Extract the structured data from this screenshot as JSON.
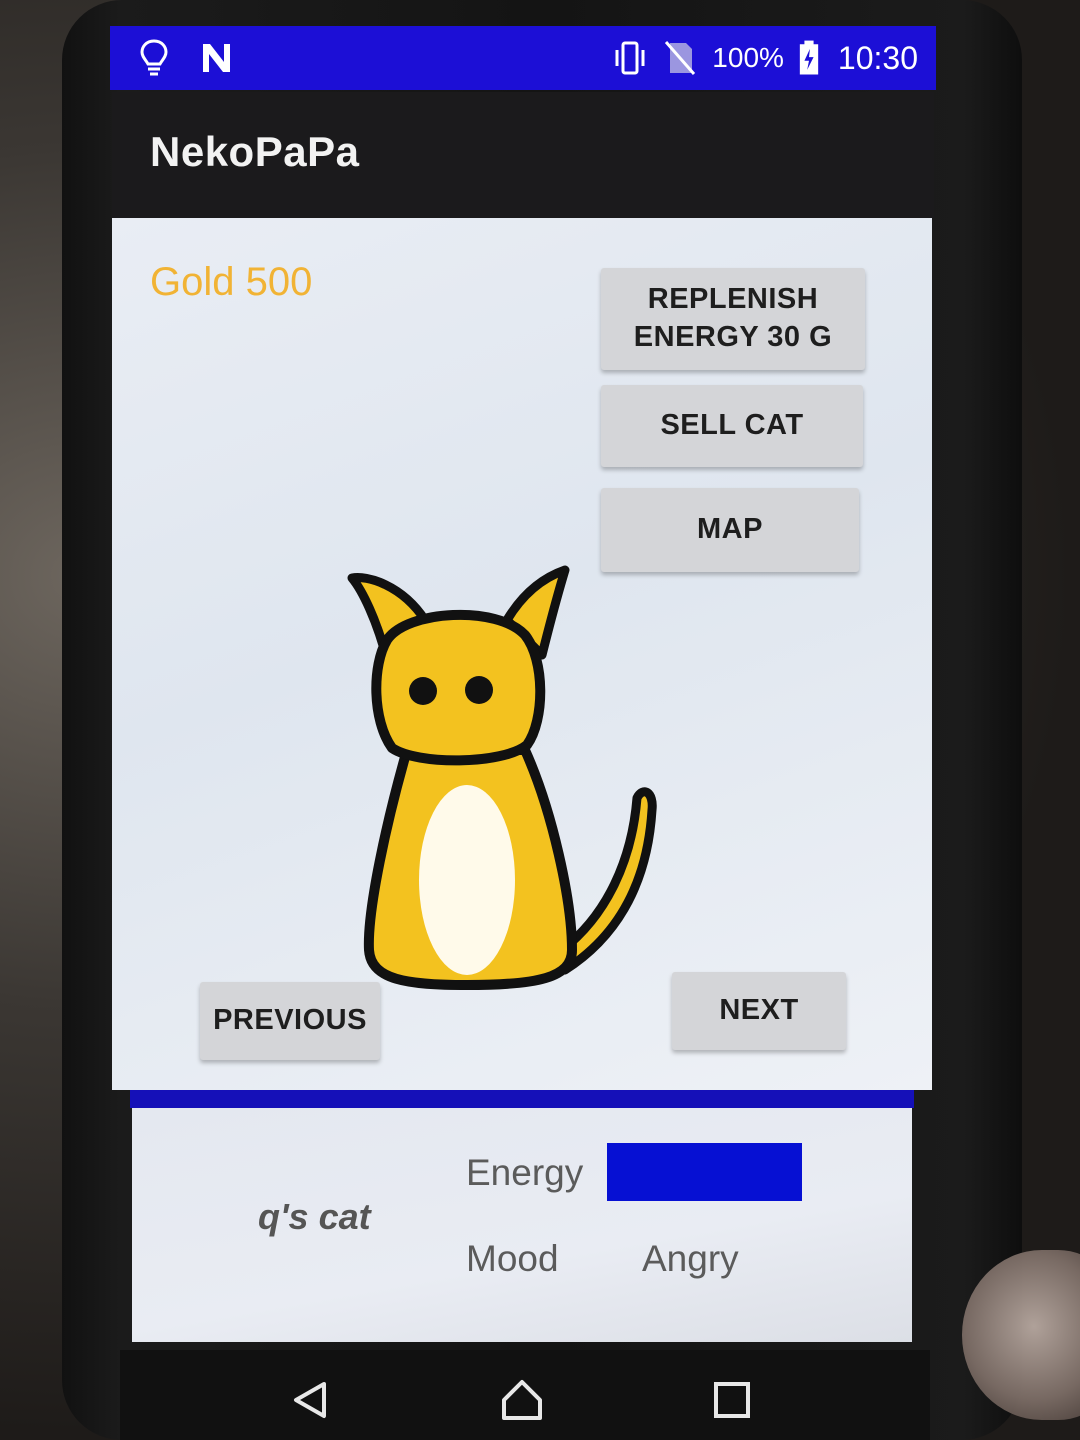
{
  "status_bar": {
    "icons_left": [
      "lightbulb-icon",
      "n-notification-icon"
    ],
    "icons_right": [
      "vibrate-icon",
      "no-sim-icon",
      "battery-charging-icon"
    ],
    "battery_percent": "100%",
    "time": "10:30"
  },
  "app_bar": {
    "title": "NekoPaPa"
  },
  "game": {
    "gold_label": "Gold 500",
    "buttons": {
      "replenish": "REPLENISH\nENERGY 30 G",
      "sell": "SELL CAT",
      "map": "MAP",
      "previous": "PREVIOUS",
      "next": "NEXT"
    },
    "cat": {
      "body_color": "#f3c21f",
      "outline_color": "#111111"
    }
  },
  "stats": {
    "cat_name": "q's cat",
    "energy_label": "Energy",
    "energy_level": 1.0,
    "energy_color": "#0610d3",
    "mood_label": "Mood",
    "mood_value": "Angry"
  },
  "nav_bar": {
    "icons": [
      "back-icon",
      "home-icon",
      "recents-icon"
    ]
  },
  "colors": {
    "status_bar": "#1c0fd6",
    "app_bar": "#1b1a1c",
    "gold_text": "#f1b334",
    "divider": "#1510b8",
    "button": "#d4d5d8"
  }
}
